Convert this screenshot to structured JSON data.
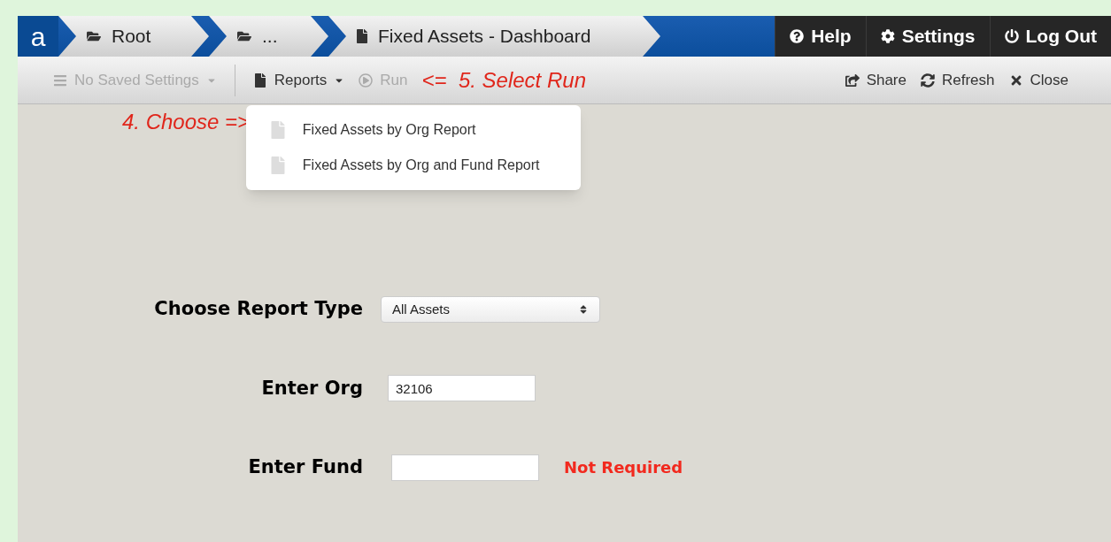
{
  "logo": "a",
  "breadcrumbs": [
    {
      "kind": "folder",
      "label": "Root"
    },
    {
      "kind": "folder",
      "label": "..."
    },
    {
      "kind": "file",
      "label": "Fixed Assets - Dashboard"
    }
  ],
  "nav_buttons": [
    {
      "kind": "help",
      "label": "Help"
    },
    {
      "kind": "settings",
      "label": "Settings"
    },
    {
      "kind": "logout",
      "label": "Log Out"
    }
  ],
  "toolbar_left": [
    {
      "kind": "saved",
      "label": "No Saved Settings",
      "disabled": true
    },
    {
      "kind": "reports",
      "label": "Reports",
      "disabled": false
    },
    {
      "kind": "run",
      "label": "Run",
      "disabled": true
    }
  ],
  "run_annotation": "<=  5. Select Run",
  "toolbar_right": [
    {
      "kind": "share",
      "label": "Share"
    },
    {
      "kind": "refresh",
      "label": "Refresh"
    },
    {
      "kind": "close",
      "label": "Close"
    }
  ],
  "choose_annotation": "4. Choose =>",
  "reports_menu": [
    "Fixed Assets by Org Report",
    "Fixed Assets by Org and Fund Report"
  ],
  "form": [
    {
      "kind": "select",
      "label": "Choose Report Type",
      "value": "All Assets"
    },
    {
      "kind": "input",
      "label": "Enter Org",
      "value": "32106"
    },
    {
      "kind": "input",
      "label": "Enter Fund",
      "note": "Not Required"
    }
  ]
}
